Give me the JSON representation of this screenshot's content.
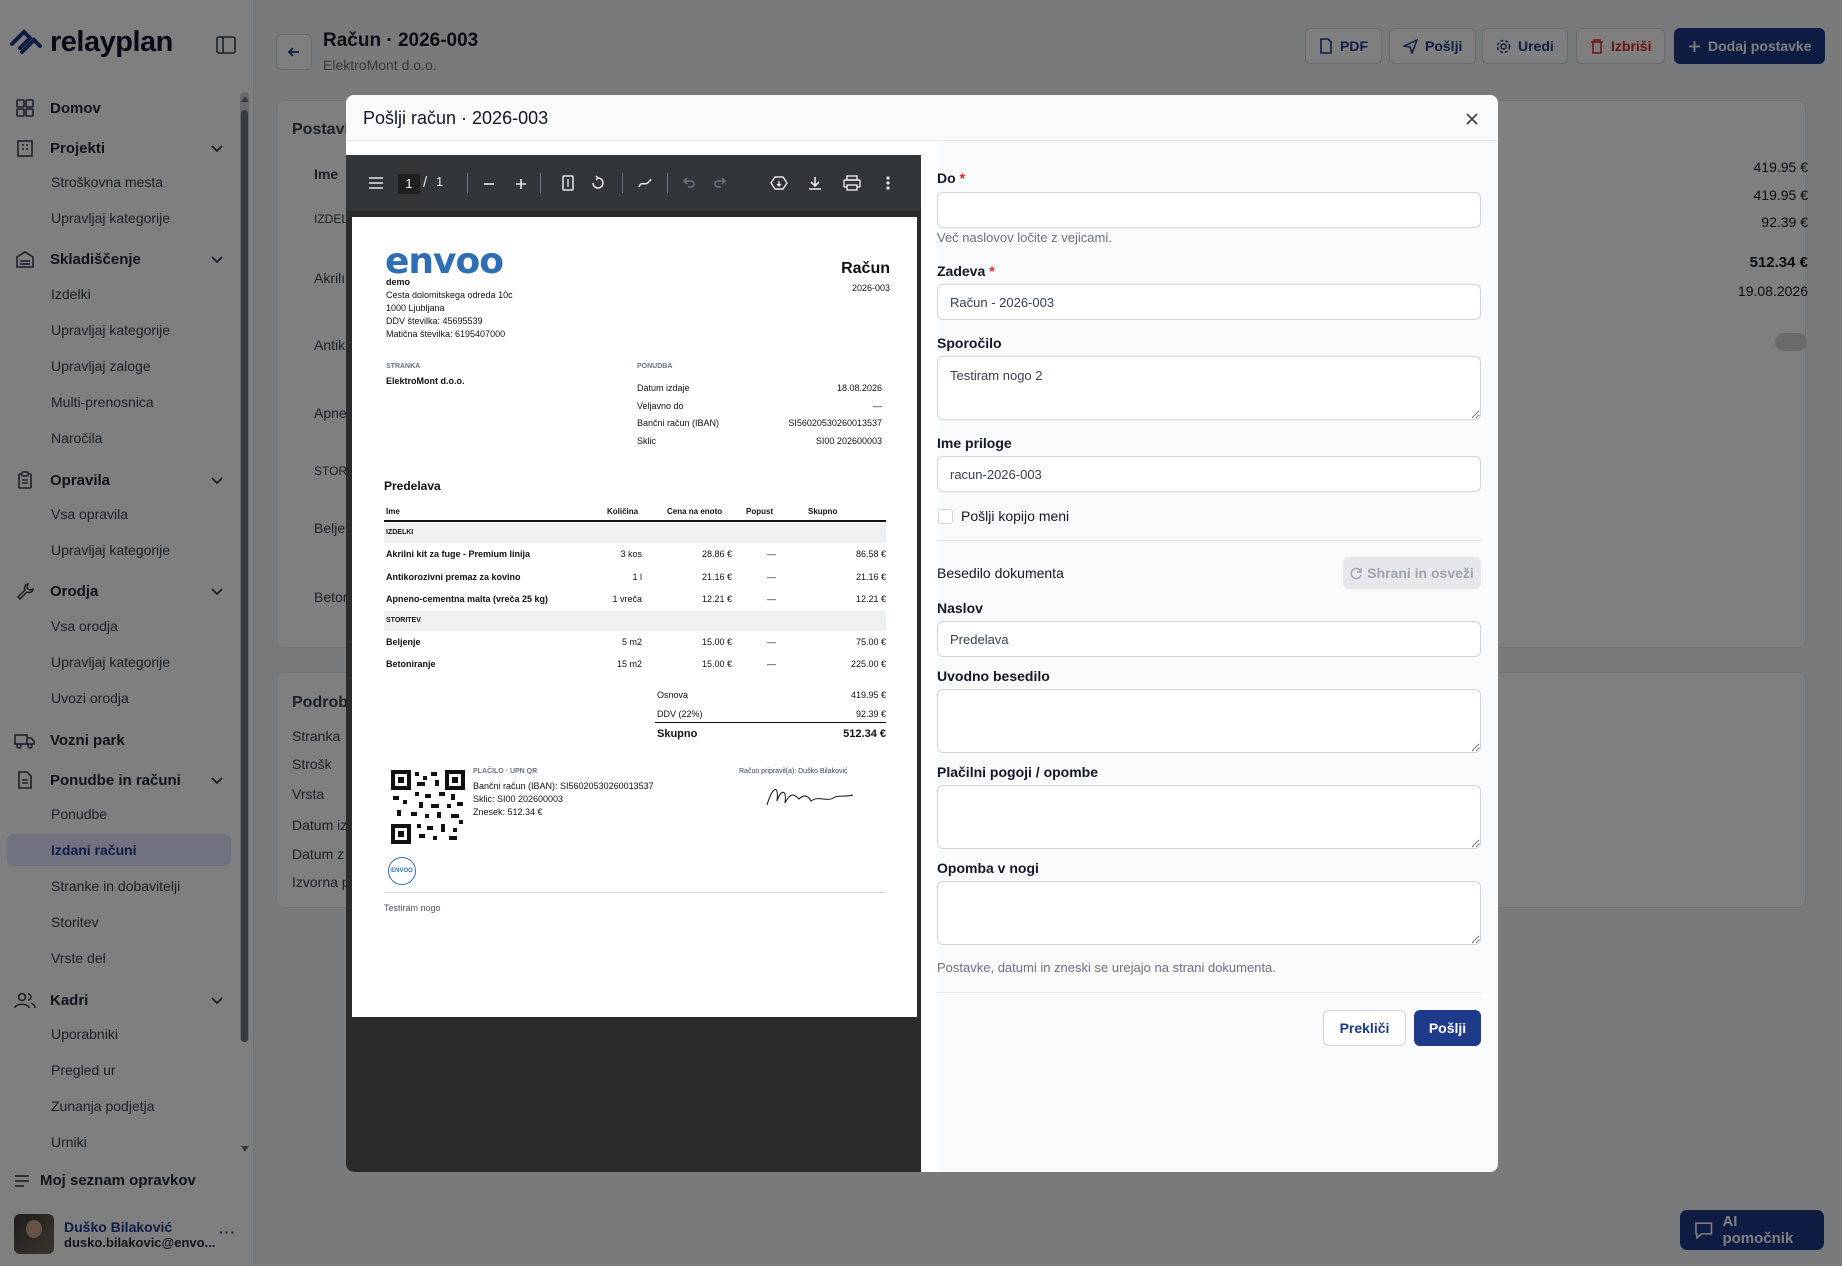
{
  "app": {
    "name": "relayplan"
  },
  "sidebar": {
    "sections": [
      {
        "label": "Domov",
        "icon": "grid-icon"
      },
      {
        "label": "Projekti",
        "icon": "building-icon",
        "items": [
          "Stroškovna mesta",
          "Upravljaj kategorije"
        ]
      },
      {
        "label": "Skladiščenje",
        "icon": "warehouse-icon",
        "items": [
          "Izdelki",
          "Upravljaj kategorije",
          "Upravljaj zaloge",
          "Multi-prenosnica",
          "Naročila"
        ]
      },
      {
        "label": "Opravila",
        "icon": "clipboard-icon",
        "items": [
          "Vsa opravila",
          "Upravljaj kategorije"
        ]
      },
      {
        "label": "Orodja",
        "icon": "wrench-icon",
        "items": [
          "Vsa orodja",
          "Upravljaj kategorije",
          "Uvozi orodja"
        ]
      },
      {
        "label": "Vozni park",
        "icon": "truck-icon"
      },
      {
        "label": "Ponudbe in računi",
        "icon": "file-icon",
        "items": [
          "Ponudbe",
          "Izdani računi",
          "Stranke in dobavitelji",
          "Storitev",
          "Vrste del"
        ]
      },
      {
        "label": "Kadri",
        "icon": "users-icon",
        "items": [
          "Uporabniki",
          "Pregled ur",
          "Zunanja podjetja",
          "Urniki"
        ]
      }
    ],
    "my_list": "Moj seznam opravkov",
    "user": {
      "name": "Duško Bilaković",
      "email": "dusko.bilakovic@envo..."
    }
  },
  "header": {
    "title": "Račun · 2026-003",
    "subtitle": "ElektroMont d.o.o.",
    "buttons": {
      "pdf": "PDF",
      "send": "Pošlji",
      "edit": "Uredi",
      "delete": "Izbriši",
      "add": "Dodaj postavke"
    }
  },
  "background": {
    "card1_title": "Postavk",
    "col_name": "Ime",
    "rows": [
      "IZDEL",
      "Akrilı",
      "Antik",
      "Apne",
      "STORI",
      "Belje",
      "Beton"
    ],
    "totals": [
      "419.95 €",
      "419.95 €",
      "92.39 €",
      "512.34 €",
      "19.08.2026"
    ],
    "card2_title": "Podrob",
    "details": [
      "Stranka",
      "Strošk",
      "Vrsta",
      "Datum iz",
      "Datum z",
      "Izvorna p"
    ]
  },
  "ai_button": "AI pomočnik",
  "modal": {
    "title": "Pošlji račun · 2026-003",
    "viewer": {
      "page": "1",
      "pages": "1"
    },
    "document": {
      "logo": "envoo",
      "company": "demo",
      "address": [
        "Cesta dolomitskega odreda 10c",
        "1000 Ljubljana",
        "DDV številka: 45695539",
        "Matična številka: 6195407000"
      ],
      "doc_title": "Račun",
      "doc_number": "2026-003",
      "client_label": "STRANKA",
      "client": "ElektroMont d.o.o.",
      "offer_label": "PONUDBA",
      "meta": [
        {
          "k": "Datum izdaje",
          "v": "18.08.2026"
        },
        {
          "k": "Veljavno do",
          "v": "—"
        },
        {
          "k": "Bančni račun (IBAN)",
          "v": "SI56020530260013537"
        },
        {
          "k": "Sklic",
          "v": "SI00 202600003"
        }
      ],
      "section_title": "Predelava",
      "table_headers": [
        "Ime",
        "Količina",
        "Cena na enoto",
        "Popust",
        "Skupno"
      ],
      "group1": "IZDELKI",
      "group2": "STORITEV",
      "rows": [
        {
          "name": "Akrilni kit za fuge - Premium linija",
          "qty": "3 kos",
          "price": "28.86 €",
          "disc": "—",
          "total": "86.58 €"
        },
        {
          "name": "Antikorozivni premaz za kovino",
          "qty": "1 l",
          "price": "21.16 €",
          "disc": "—",
          "total": "21.16 €"
        },
        {
          "name": "Apneno-cementna malta (vreča 25 kg)",
          "qty": "1 vreča",
          "price": "12.21 €",
          "disc": "—",
          "total": "12.21 €"
        },
        {
          "name": "Beljenje",
          "qty": "5 m2",
          "price": "15.00 €",
          "disc": "—",
          "total": "75.00 €"
        },
        {
          "name": "Betoniranje",
          "qty": "15 m2",
          "price": "15.00 €",
          "disc": "—",
          "total": "225.00 €"
        }
      ],
      "sum": [
        {
          "k": "Osnova",
          "v": "419.95 €"
        },
        {
          "k": "DDV (22%)",
          "v": "92.39 €"
        },
        {
          "k": "Skupno",
          "v": "512.34 €"
        }
      ],
      "payment_label": "PLAČILO · UPN QR",
      "payment": [
        "Bančni račun (IBAN): SI56020530260013537",
        "Sklic: SI00 202600003",
        "Znesek: 512.34 €"
      ],
      "prepared": "Račun pripravil(a): Duško Bilaković",
      "stamp": "ENVOO",
      "footer_note": "Testiram nogo"
    },
    "form": {
      "to_label": "Do",
      "to_value": "",
      "to_hint": "Več naslovov ločite z vejicami.",
      "subject_label": "Zadeva",
      "subject_value": "Račun - 2026-003",
      "message_label": "Sporočilo",
      "message_value": "Testiram nogo 2",
      "attachment_label": "Ime priloge",
      "attachment_value": "racun-2026-003",
      "copy_label": "Pošlji kopijo meni",
      "doc_text_label": "Besedilo dokumenta",
      "save_refresh": "Shrani in osveži",
      "heading_label": "Naslov",
      "heading_value": "Predelava",
      "intro_label": "Uvodno besedilo",
      "terms_label": "Plačilni pogoji / opombe",
      "footer_label": "Opomba v nogi",
      "footer_hint": "Postavke, datumi in zneski se urejajo na strani dokumenta.",
      "cancel": "Prekliči",
      "send": "Pošlji"
    }
  },
  "colors": {
    "primary": "#1e3a8a",
    "danger": "#dc2626",
    "active_bg": "#e0e7ff"
  }
}
